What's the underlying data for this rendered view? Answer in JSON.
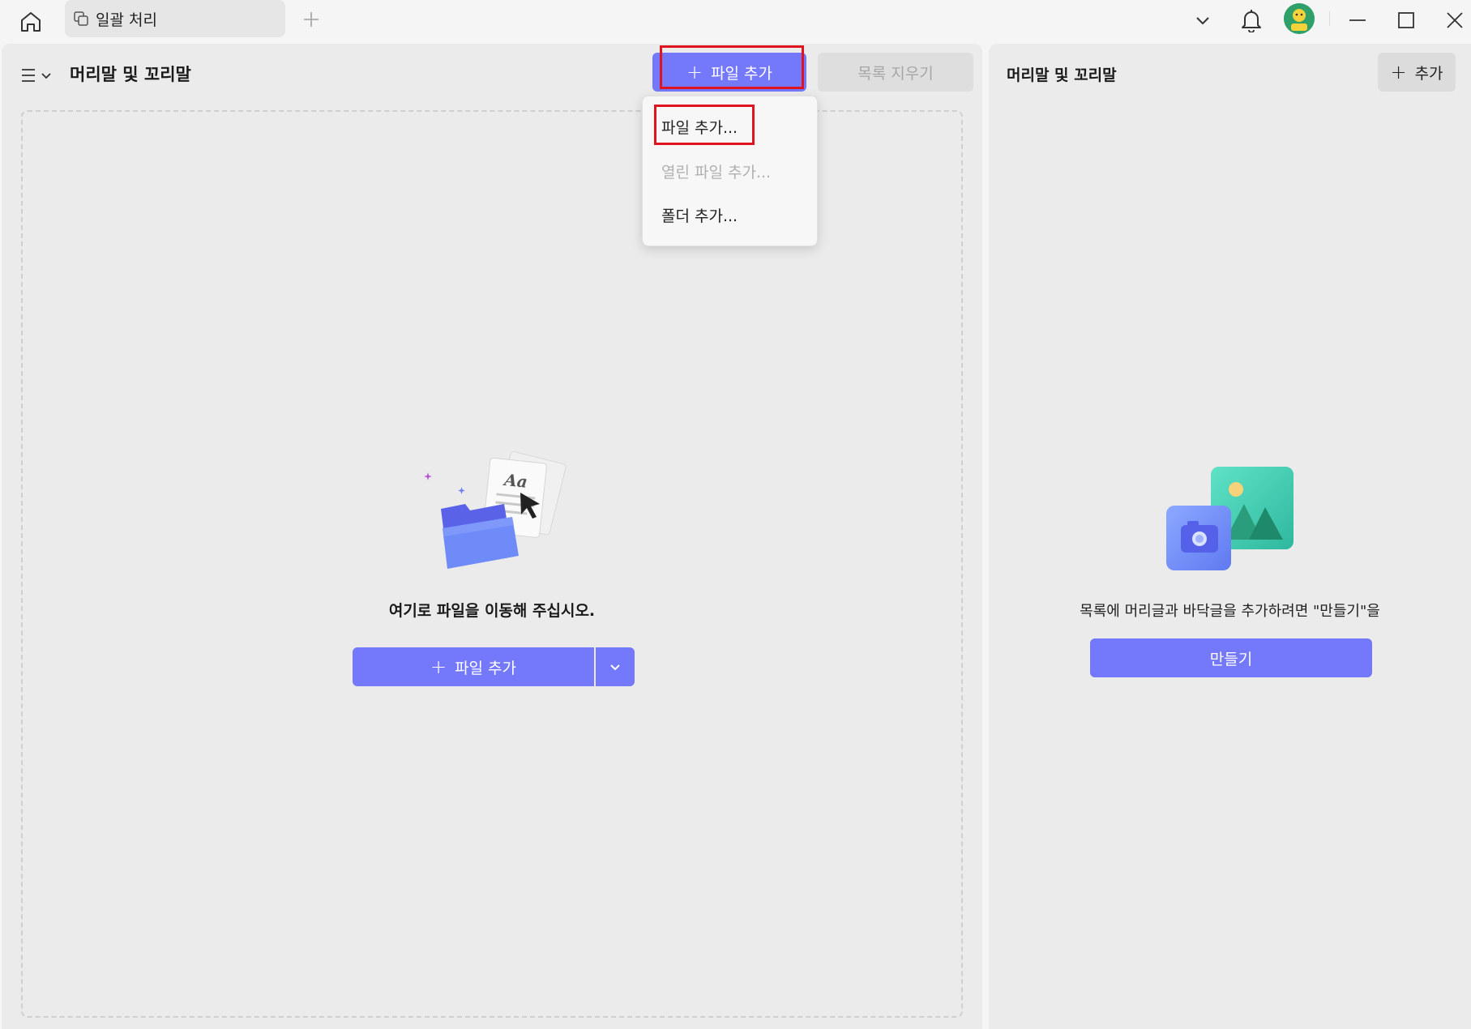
{
  "titlebar": {
    "tab_label": "일괄 처리",
    "icons": [
      "home-icon",
      "batch-icon",
      "plus-icon",
      "chevron-down-icon",
      "bell-icon",
      "avatar",
      "minimize-icon",
      "maximize-icon",
      "close-icon"
    ]
  },
  "left_panel": {
    "title": "머리말 및 꼬리말",
    "add_file_label": "파일 추가",
    "clear_list_label": "목록 지우기",
    "dropdown": {
      "items": [
        {
          "label": "파일 추가...",
          "enabled": true
        },
        {
          "label": "열린 파일 추가...",
          "enabled": false
        },
        {
          "label": "폴더 추가...",
          "enabled": true
        }
      ]
    },
    "drop_hint": "여기로 파일을 이동해 주십시오.",
    "split_add_label": "파일 추가",
    "illustration": {
      "text": "Aa"
    }
  },
  "right_panel": {
    "title": "머리말 및 꼬리말",
    "add_label": "추가",
    "message": "목록에 머리글과 바닥글을 추가하려면 \"만들기\"을",
    "create_label": "만들기"
  },
  "colors": {
    "accent": "#7478fa",
    "highlight": "#e0141e",
    "panel": "#ebebeb"
  }
}
